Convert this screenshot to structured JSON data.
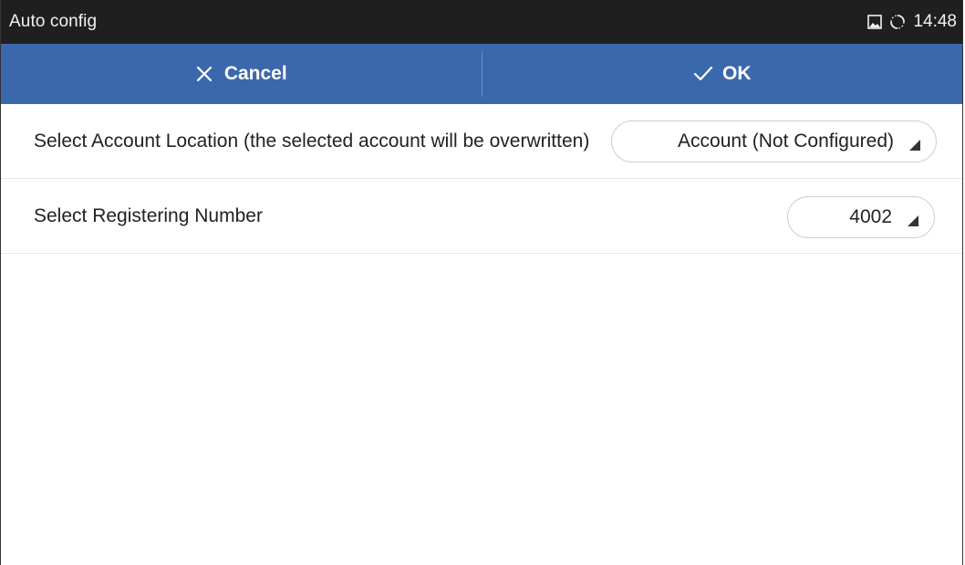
{
  "status_bar": {
    "title": "Auto config",
    "time": "14:48",
    "icons": [
      "picture-icon",
      "sync-icon"
    ]
  },
  "action_bar": {
    "cancel_label": "Cancel",
    "ok_label": "OK",
    "background_color": "#3b68ad"
  },
  "settings": [
    {
      "label": "Select Account Location (the selected account will be overwritten)",
      "value": "Account (Not Configured)"
    },
    {
      "label": "Select Registering Number",
      "value": "4002"
    }
  ]
}
